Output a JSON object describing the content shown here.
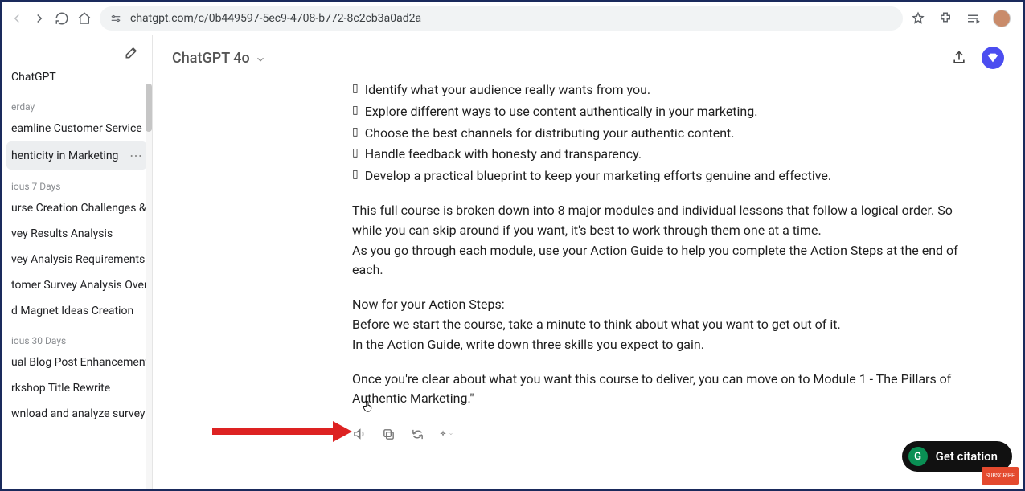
{
  "browser": {
    "url": "chatgpt.com/c/0b449597-5ec9-4708-b772-8c2cb3a0ad2a"
  },
  "sidebar": {
    "topItem": "ChatGPT",
    "sections": [
      {
        "label": "erday",
        "items": [
          "eamline Customer Service Pro",
          "henticity in Marketing"
        ],
        "activeIndex": 1
      },
      {
        "label": "ious 7 Days",
        "items": [
          "urse Creation Challenges & Re",
          "vey Results Analysis",
          "vey Analysis Requirements Cl",
          "tomer Survey Analysis Overvi",
          "d Magnet Ideas Creation"
        ]
      },
      {
        "label": "ious 30 Days",
        "items": [
          "ual Blog Post Enhancement",
          "rkshop Title Rewrite",
          "wnload and analyze survey da"
        ]
      }
    ]
  },
  "header": {
    "model": "ChatGPT 4o"
  },
  "content": {
    "bullets": [
      "Identify what your audience really wants from you.",
      "Explore different ways to use content authentically in your marketing.",
      "Choose the best channels for distributing your authentic content.",
      "Handle feedback with honesty and transparency.",
      "Develop a practical blueprint to keep your marketing efforts genuine and effective."
    ],
    "para1a": "This full course is broken down into 8 major modules and individual lessons that follow a logical order. So while you can skip around if you want, it's best to work through them one at a time.",
    "para1b": "As you go through each module, use your Action Guide to help you complete the Action Steps at the end of each.",
    "para2a": "Now for your Action Steps:",
    "para2b": "Before we start the course, take a minute to think about what you want to get out of it.",
    "para2c": "In the Action Guide, write down three skills you expect to gain.",
    "para3": "Once you're clear about what you want this course to deliver, you can move on to Module 1 - The Pillars of Authentic Marketing.\""
  },
  "citation": {
    "label": "Get citation"
  }
}
